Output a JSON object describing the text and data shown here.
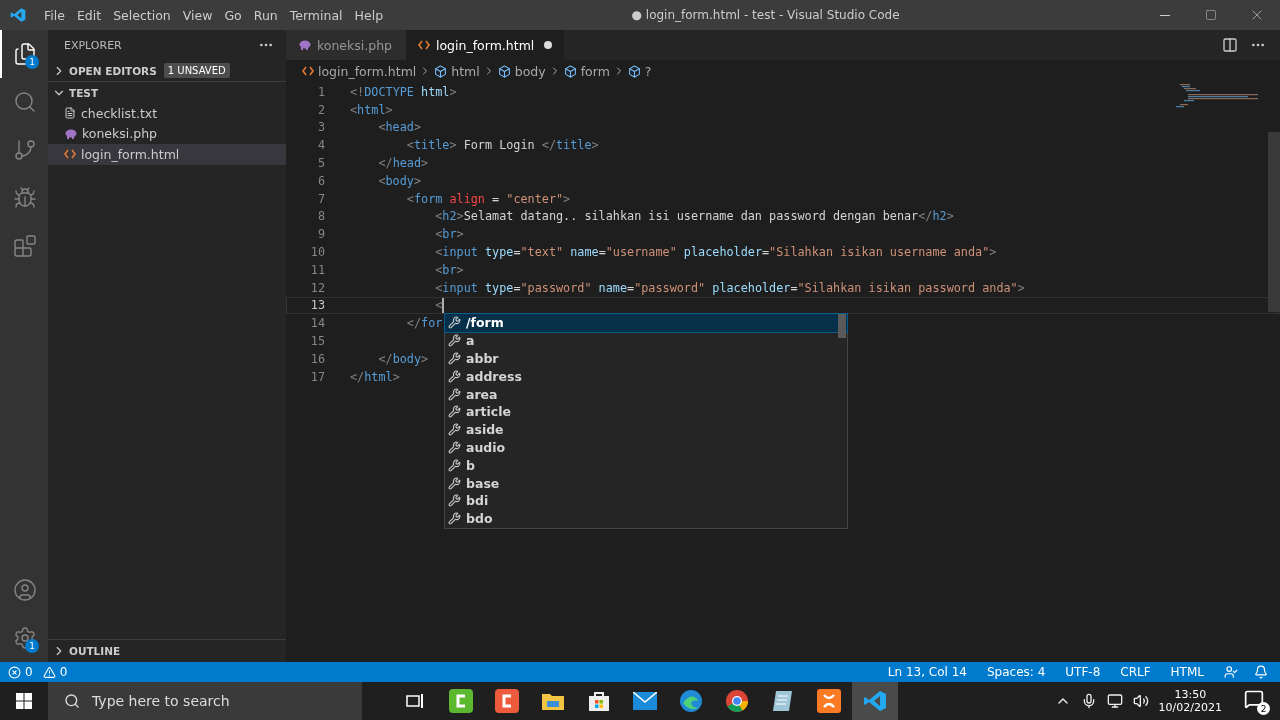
{
  "title_bar": {
    "menu": [
      "File",
      "Edit",
      "Selection",
      "View",
      "Go",
      "Run",
      "Terminal",
      "Help"
    ],
    "title": "● login_form.html - test - Visual Studio Code"
  },
  "activity_bar": {
    "top": [
      {
        "kind": "files",
        "selected": true,
        "badge": "1"
      },
      {
        "kind": "search",
        "selected": false
      },
      {
        "kind": "source-control",
        "selected": false
      },
      {
        "kind": "run",
        "selected": false
      },
      {
        "kind": "extensions",
        "selected": false
      }
    ],
    "bottom": [
      {
        "kind": "account",
        "selected": false
      },
      {
        "kind": "settings",
        "selected": false,
        "badge": "1"
      }
    ]
  },
  "sidebar": {
    "title": "EXPLORER",
    "open_editors": {
      "label": "OPEN EDITORS",
      "badge": "1 UNSAVED",
      "expanded": false
    },
    "folder": {
      "label": "TEST",
      "expanded": true,
      "files": [
        {
          "name": "checklist.txt",
          "kind": "txt",
          "selected": false
        },
        {
          "name": "koneksi.php",
          "kind": "php",
          "selected": false
        },
        {
          "name": "login_form.html",
          "kind": "html",
          "selected": true
        }
      ]
    },
    "outline": {
      "label": "OUTLINE",
      "expanded": false
    }
  },
  "tabs": [
    {
      "label": "koneksi.php",
      "kind": "php",
      "selected": false,
      "dirty": false
    },
    {
      "label": "login_form.html",
      "kind": "html",
      "selected": true,
      "dirty": true
    }
  ],
  "breadcrumbs": [
    {
      "label": "login_form.html",
      "kind": "html"
    },
    {
      "label": "html",
      "kind": "element"
    },
    {
      "label": "body",
      "kind": "element"
    },
    {
      "label": "form",
      "kind": "element"
    },
    {
      "label": "?",
      "kind": "element"
    }
  ],
  "code": [
    {
      "number": "1",
      "current": false,
      "tokens": [
        {
          "kind": "punct",
          "text": "<!"
        },
        {
          "kind": "tag",
          "text": "DOCTYPE"
        },
        {
          "kind": "attr",
          "text": " html"
        },
        {
          "kind": "punct",
          "text": ">"
        }
      ]
    },
    {
      "number": "2",
      "current": false,
      "tokens": [
        {
          "kind": "punct",
          "text": "<"
        },
        {
          "kind": "tag",
          "text": "html"
        },
        {
          "kind": "punct",
          "text": ">"
        }
      ]
    },
    {
      "number": "3",
      "current": false,
      "tokens": [
        {
          "kind": "punct",
          "text": "    <"
        },
        {
          "kind": "tag",
          "text": "head"
        },
        {
          "kind": "punct",
          "text": ">"
        }
      ]
    },
    {
      "number": "4",
      "current": false,
      "tokens": [
        {
          "kind": "punct",
          "text": "        <"
        },
        {
          "kind": "tag",
          "text": "title"
        },
        {
          "kind": "punct",
          "text": ">"
        },
        {
          "kind": "text",
          "text": " Form Login "
        },
        {
          "kind": "punct",
          "text": "</"
        },
        {
          "kind": "tag",
          "text": "title"
        },
        {
          "kind": "punct",
          "text": ">"
        }
      ]
    },
    {
      "number": "5",
      "current": false,
      "tokens": [
        {
          "kind": "punct",
          "text": "    </"
        },
        {
          "kind": "tag",
          "text": "head"
        },
        {
          "kind": "punct",
          "text": ">"
        }
      ]
    },
    {
      "number": "6",
      "current": false,
      "tokens": [
        {
          "kind": "punct",
          "text": "    <"
        },
        {
          "kind": "tag",
          "text": "body"
        },
        {
          "kind": "punct",
          "text": ">"
        }
      ]
    },
    {
      "number": "7",
      "current": false,
      "tokens": [
        {
          "kind": "punct",
          "text": "        <"
        },
        {
          "kind": "tag",
          "text": "form"
        },
        {
          "kind": "deprecated",
          "text": " align"
        },
        {
          "kind": "text",
          "text": " = "
        },
        {
          "kind": "string",
          "text": "\"center\""
        },
        {
          "kind": "punct",
          "text": ">"
        }
      ]
    },
    {
      "number": "8",
      "current": false,
      "tokens": [
        {
          "kind": "punct",
          "text": "            <"
        },
        {
          "kind": "tag",
          "text": "h2"
        },
        {
          "kind": "punct",
          "text": ">"
        },
        {
          "kind": "text",
          "text": "Selamat datang.. silahkan isi username dan password dengan benar"
        },
        {
          "kind": "punct",
          "text": "</"
        },
        {
          "kind": "tag",
          "text": "h2"
        },
        {
          "kind": "punct",
          "text": ">"
        }
      ]
    },
    {
      "number": "9",
      "current": false,
      "tokens": [
        {
          "kind": "punct",
          "text": "            <"
        },
        {
          "kind": "tag",
          "text": "br"
        },
        {
          "kind": "punct",
          "text": ">"
        }
      ]
    },
    {
      "number": "10",
      "current": false,
      "tokens": [
        {
          "kind": "punct",
          "text": "            <"
        },
        {
          "kind": "tag",
          "text": "input"
        },
        {
          "kind": "attr",
          "text": " type"
        },
        {
          "kind": "text",
          "text": "="
        },
        {
          "kind": "string",
          "text": "\"text\""
        },
        {
          "kind": "attr",
          "text": " name"
        },
        {
          "kind": "text",
          "text": "="
        },
        {
          "kind": "string",
          "text": "\"username\""
        },
        {
          "kind": "attr",
          "text": " placeholder"
        },
        {
          "kind": "text",
          "text": "="
        },
        {
          "kind": "string",
          "text": "\"Silahkan isikan username anda\""
        },
        {
          "kind": "punct",
          "text": ">"
        }
      ]
    },
    {
      "number": "11",
      "current": false,
      "tokens": [
        {
          "kind": "punct",
          "text": "            <"
        },
        {
          "kind": "tag",
          "text": "br"
        },
        {
          "kind": "punct",
          "text": ">"
        }
      ]
    },
    {
      "number": "12",
      "current": false,
      "tokens": [
        {
          "kind": "punct",
          "text": "            <"
        },
        {
          "kind": "tag",
          "text": "input"
        },
        {
          "kind": "attr",
          "text": " type"
        },
        {
          "kind": "text",
          "text": "="
        },
        {
          "kind": "string",
          "text": "\"password\""
        },
        {
          "kind": "attr",
          "text": " name"
        },
        {
          "kind": "text",
          "text": "="
        },
        {
          "kind": "string",
          "text": "\"password\""
        },
        {
          "kind": "attr",
          "text": " placeholder"
        },
        {
          "kind": "text",
          "text": "="
        },
        {
          "kind": "string",
          "text": "\"Silahkan isikan password anda\""
        },
        {
          "kind": "punct",
          "text": ">"
        }
      ]
    },
    {
      "number": "13",
      "current": true,
      "tokens": [
        {
          "kind": "punct",
          "text": "            <"
        }
      ]
    },
    {
      "number": "14",
      "current": false,
      "tokens": [
        {
          "kind": "punct",
          "text": "        </"
        },
        {
          "kind": "tag",
          "text": "for"
        }
      ]
    },
    {
      "number": "15",
      "current": false
    },
    {
      "number": "16",
      "current": false,
      "tokens": [
        {
          "kind": "punct",
          "text": "    </"
        },
        {
          "kind": "tag",
          "text": "body"
        },
        {
          "kind": "punct",
          "text": ">"
        }
      ]
    },
    {
      "number": "17",
      "current": false,
      "tokens": [
        {
          "kind": "punct",
          "text": "</"
        },
        {
          "kind": "tag",
          "text": "html"
        },
        {
          "kind": "punct",
          "text": ">"
        }
      ]
    }
  ],
  "suggestions": [
    {
      "label": "/form",
      "selected": true
    },
    {
      "label": "a",
      "selected": false
    },
    {
      "label": "abbr",
      "selected": false
    },
    {
      "label": "address",
      "selected": false
    },
    {
      "label": "area",
      "selected": false
    },
    {
      "label": "article",
      "selected": false
    },
    {
      "label": "aside",
      "selected": false
    },
    {
      "label": "audio",
      "selected": false
    },
    {
      "label": "b",
      "selected": false
    },
    {
      "label": "base",
      "selected": false
    },
    {
      "label": "bdi",
      "selected": false
    },
    {
      "label": "bdo",
      "selected": false
    }
  ],
  "status_bar": {
    "errors": "0",
    "warnings": "0",
    "right": [
      "Ln 13, Col 14",
      "Spaces: 4",
      "UTF-8",
      "CRLF",
      "HTML"
    ]
  },
  "taskbar": {
    "search": {
      "placeholder": "Type here to search"
    },
    "apps": [
      {
        "kind": "task-view",
        "selected": false
      },
      {
        "kind": "green-app",
        "selected": false
      },
      {
        "kind": "red-app",
        "selected": false
      },
      {
        "kind": "folder",
        "selected": false
      },
      {
        "kind": "store",
        "selected": false
      },
      {
        "kind": "mail",
        "selected": false
      },
      {
        "kind": "edge",
        "selected": false
      },
      {
        "kind": "chrome",
        "selected": false
      },
      {
        "kind": "notepad",
        "selected": false
      },
      {
        "kind": "xampp",
        "selected": false
      },
      {
        "kind": "vscode",
        "selected": true
      }
    ],
    "time": "13:50",
    "date": "10/02/2021",
    "notifications": "2"
  }
}
